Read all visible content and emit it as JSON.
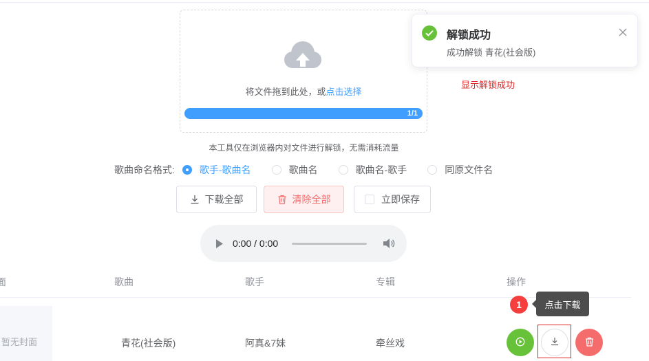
{
  "upload": {
    "drop_text": "将文件拖到此处，或",
    "select_link": "点击选择",
    "progress_text": "1/1",
    "progress": 1.0
  },
  "tip": "本工具仅在浏览器内对文件进行解锁，无需消耗流量",
  "naming": {
    "label": "歌曲命名格式:",
    "options": [
      {
        "label": "歌手-歌曲名",
        "checked": true
      },
      {
        "label": "歌曲名",
        "checked": false
      },
      {
        "label": "歌曲名-歌手",
        "checked": false
      },
      {
        "label": "同原文件名",
        "checked": false
      }
    ]
  },
  "actions": {
    "download_all": "下载全部",
    "clear_all": "清除全部",
    "save_now": "立即保存"
  },
  "player": {
    "time": "0:00 / 0:00"
  },
  "table": {
    "headers": {
      "cover": "面",
      "song": "歌曲",
      "artist": "歌手",
      "album": "专辑",
      "ops": "操作"
    },
    "rows": [
      {
        "cover_text": "暂无封面",
        "song": "青花(社会版)",
        "artist": "阿真&7妹",
        "album": "牵丝戏"
      }
    ]
  },
  "annotation": {
    "badge": "1",
    "tooltip": "点击下载",
    "notice": "显示解锁成功"
  },
  "notification": {
    "title": "解锁成功",
    "message": "成功解锁 青花(社会版)"
  },
  "colors": {
    "primary": "#409eff",
    "success": "#67c23a",
    "danger": "#f56c6c",
    "annotation_red": "#e02020"
  },
  "icons": [
    "upload-cloud-icon",
    "download-icon",
    "delete-icon",
    "play-icon",
    "volume-icon",
    "success-check-icon",
    "close-icon"
  ]
}
